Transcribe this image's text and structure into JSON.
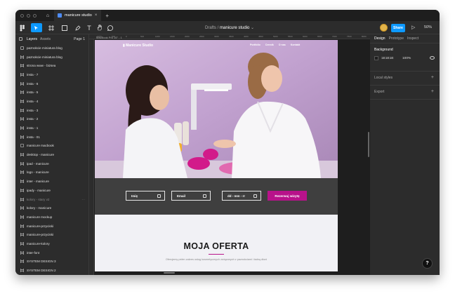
{
  "titlebar": {
    "file_tab": "manicure studio",
    "close": "×",
    "new_tab": "+"
  },
  "toolbar": {
    "breadcrumb_parent": "Drafts",
    "breadcrumb_sep": " / ",
    "file_name": "manicure studio",
    "share_label": "Share",
    "zoom": "50%"
  },
  "layers_panel": {
    "tab_layers": "Layers",
    "tab_assets": "Assets",
    "page": "Page 1",
    "items": [
      {
        "label": "paznokcie miniatura blog",
        "type": "image"
      },
      {
        "label": "paznokcie miniatura blog",
        "type": "grid"
      },
      {
        "label": "strona www - bizsea",
        "type": "grid"
      },
      {
        "label": "insta - 7",
        "type": "grid"
      },
      {
        "label": "insta - 6",
        "type": "grid"
      },
      {
        "label": "insta - 5",
        "type": "grid"
      },
      {
        "label": "insta - 4",
        "type": "grid"
      },
      {
        "label": "insta - 3",
        "type": "grid"
      },
      {
        "label": "insta - 2",
        "type": "grid"
      },
      {
        "label": "insta - 1",
        "type": "grid"
      },
      {
        "label": "insta - 01",
        "type": "grid"
      },
      {
        "label": "manicure macbook",
        "type": "dashed"
      },
      {
        "label": "desktop - manicure",
        "type": "grid"
      },
      {
        "label": "ipad - manicure",
        "type": "grid"
      },
      {
        "label": "logo - manicure",
        "type": "grid"
      },
      {
        "label": "inter - manicure",
        "type": "grid"
      },
      {
        "label": "ipady - manicure",
        "type": "grid"
      },
      {
        "label": "kolory - stary v2",
        "type": "grid",
        "dim": true
      },
      {
        "label": "kolory - manicure",
        "type": "grid"
      },
      {
        "label": "manicure mockup",
        "type": "grid"
      },
      {
        "label": "manicure-przyciski",
        "type": "grid"
      },
      {
        "label": "manicure-przyciski",
        "type": "grid"
      },
      {
        "label": "manicure-kolory",
        "type": "grid"
      },
      {
        "label": "inter-font",
        "type": "grid"
      },
      {
        "label": "SYSTEM DESIGN 3",
        "type": "grid"
      },
      {
        "label": "SYSTEM DESIGN 2",
        "type": "grid"
      }
    ]
  },
  "canvas": {
    "frame_label": "MacBook Pro 16\" - 1",
    "ruler_marks": [
      "-1000",
      "-500",
      "0",
      "500",
      "1000",
      "1500",
      "2000",
      "2500",
      "3000",
      "3500",
      "4000",
      "4500",
      "5000",
      "5500",
      "6000",
      "6500",
      "7000",
      "7500",
      "8000"
    ],
    "site": {
      "logo": "Manicure Studio",
      "nav": [
        "Portfolio",
        "Cennik",
        "O nas",
        "Kontakt"
      ],
      "form": {
        "name": "Imię",
        "email": "Email",
        "date": "dd - mm - rr",
        "button": "Rezerwuj wizytę"
      },
      "offer_title": "MOJA OFERTA",
      "offer_subtitle": "Oferujemy pełen zakres usług kosmetycznych związanych z paznokciami i ładną dłoni"
    }
  },
  "properties_panel": {
    "tabs": [
      "Design",
      "Prototype",
      "Inspect"
    ],
    "background_title": "Background",
    "bg_hex": "1E1E1E",
    "bg_opacity": "100%",
    "local_styles": "Local styles",
    "export": "Export"
  },
  "help": "?",
  "colors": {
    "accent": "#0d99ff",
    "brand": "#b8128a",
    "bg": "#1e1e1e"
  }
}
